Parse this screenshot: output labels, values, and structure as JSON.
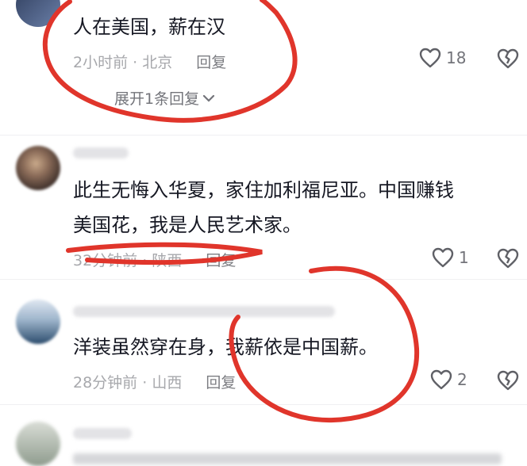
{
  "comments": [
    {
      "text_lines": [
        "人在美国，薪在汉"
      ],
      "time": "2小时前",
      "location": "北京",
      "reply_label": "回复",
      "likes": "18",
      "expand_label": "展开1条回复"
    },
    {
      "text_lines": [
        "此生无悔入华夏，家住加利福尼亚。中国赚钱",
        "美国花，我是人民艺术家。"
      ],
      "time": "32分钟前",
      "location": "陕西",
      "reply_label": "回复",
      "likes": "1"
    },
    {
      "text_lines": [
        "洋装虽然穿在身，我薪依是中国薪。"
      ],
      "time": "28分钟前",
      "location": "山西",
      "reply_label": "回复",
      "likes": "2"
    }
  ],
  "colors": {
    "annotation_red": "#e0352b",
    "meta_gray": "#a7a8ac",
    "text": "#161823"
  },
  "icons": {
    "like": "heart-outline-icon",
    "dislike": "broken-heart-icon",
    "expand": "chevron-down-icon"
  }
}
